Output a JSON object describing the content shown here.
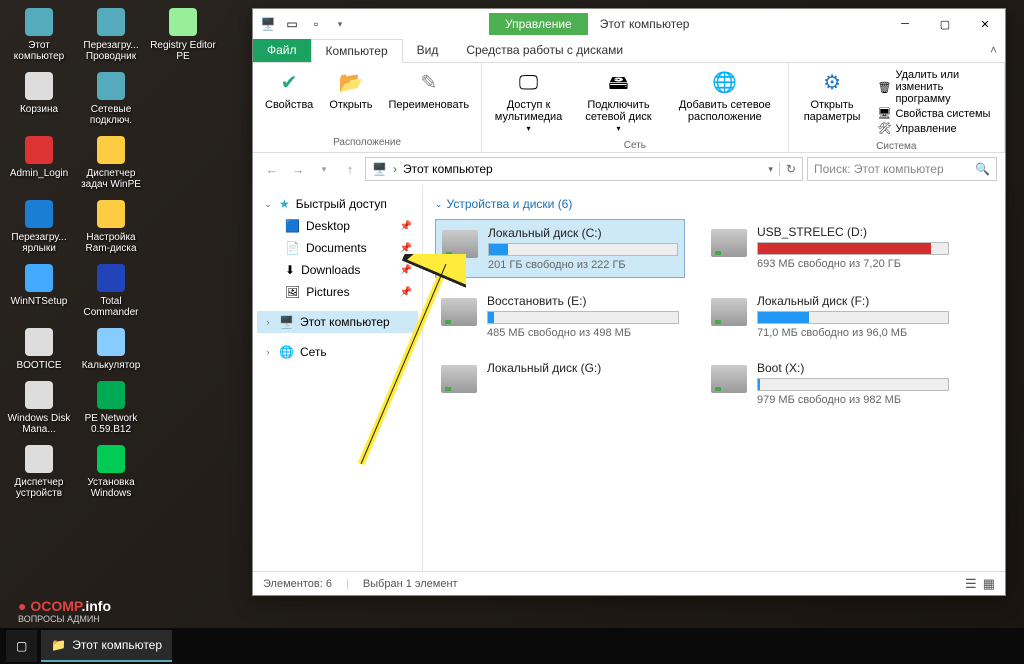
{
  "desktop_icons": [
    {
      "label": "Этот компьютер",
      "color": "#5ab"
    },
    {
      "label": "Перезагру... Проводник",
      "color": "#5ab"
    },
    {
      "label": "Registry Editor PE",
      "color": "#9e9"
    },
    {
      "label": "Корзина",
      "color": "#ddd"
    },
    {
      "label": "Сетевые подключ.",
      "color": "#5ab"
    },
    {
      "label": "",
      "color": ""
    },
    {
      "label": "Admin_Login",
      "color": "#d33"
    },
    {
      "label": "Диспетчер задач WinPE",
      "color": "#fc4"
    },
    {
      "label": "",
      "color": ""
    },
    {
      "label": "Перезагру... ярлыки",
      "color": "#1a7fd4"
    },
    {
      "label": "Настройка Ram-диска",
      "color": "#fc4"
    },
    {
      "label": "",
      "color": ""
    },
    {
      "label": "WinNTSetup",
      "color": "#4af"
    },
    {
      "label": "Total Commander",
      "color": "#24b"
    },
    {
      "label": "",
      "color": ""
    },
    {
      "label": "BOOTICE",
      "color": "#ddd"
    },
    {
      "label": "Калькулятор",
      "color": "#8cf"
    },
    {
      "label": "",
      "color": ""
    },
    {
      "label": "Windows Disk Mana...",
      "color": "#ddd"
    },
    {
      "label": "PE Network 0.59.B12",
      "color": "#0a5"
    },
    {
      "label": "",
      "color": ""
    },
    {
      "label": "Диспетчер устройств",
      "color": "#ddd"
    },
    {
      "label": "Установка Windows",
      "color": "#0c5"
    }
  ],
  "window": {
    "title_tab": "Управление",
    "title": "Этот компьютер",
    "tabs": {
      "file": "Файл",
      "computer": "Компьютер",
      "view": "Вид",
      "tools": "Средства работы с дисками"
    },
    "ribbon": {
      "location": {
        "label": "Расположение",
        "props": "Свойства",
        "open": "Открыть",
        "rename": "Переименовать"
      },
      "network": {
        "label": "Сеть",
        "media": "Доступ к мультимедиа",
        "map": "Подключить сетевой диск",
        "addnet": "Добавить сетевое расположение"
      },
      "system": {
        "label": "Система",
        "settings": "Открыть параметры",
        "uninstall": "Удалить или изменить программу",
        "sysprops": "Свойства системы",
        "manage": "Управление"
      }
    },
    "nav": {
      "path": "Этот компьютер",
      "search_placeholder": "Поиск: Этот компьютер"
    },
    "sidebar": {
      "quick": "Быстрый доступ",
      "items": [
        "Desktop",
        "Documents",
        "Downloads",
        "Pictures"
      ],
      "thispc": "Этот компьютер",
      "network": "Сеть"
    },
    "section": "Устройства и диски (6)",
    "drives": [
      {
        "name": "Локальный диск (C:)",
        "free": "201 ГБ свободно из 222 ГБ",
        "fill": 10,
        "red": false,
        "hasbar": true
      },
      {
        "name": "USB_STRELEC (D:)",
        "free": "693 МБ свободно из 7,20 ГБ",
        "fill": 91,
        "red": true,
        "hasbar": true
      },
      {
        "name": "Восстановить (E:)",
        "free": "485 МБ свободно из 498 МБ",
        "fill": 3,
        "red": false,
        "hasbar": true
      },
      {
        "name": "Локальный диск (F:)",
        "free": "71,0 МБ свободно из 96,0 МБ",
        "fill": 27,
        "red": false,
        "hasbar": true
      },
      {
        "name": "Локальный диск (G:)",
        "free": "",
        "fill": 0,
        "red": false,
        "hasbar": false
      },
      {
        "name": "Boot (X:)",
        "free": "979 МБ свободно из 982 МБ",
        "fill": 1,
        "red": false,
        "hasbar": true
      }
    ],
    "status": {
      "count": "Элементов: 6",
      "sel": "Выбран 1 элемент"
    }
  },
  "taskbar": {
    "app": "Этот компьютер"
  },
  "watermark": {
    "brand": "OCOMP",
    "tld": ".info",
    "sub": "ВОПРОСЫ АДМИН"
  }
}
